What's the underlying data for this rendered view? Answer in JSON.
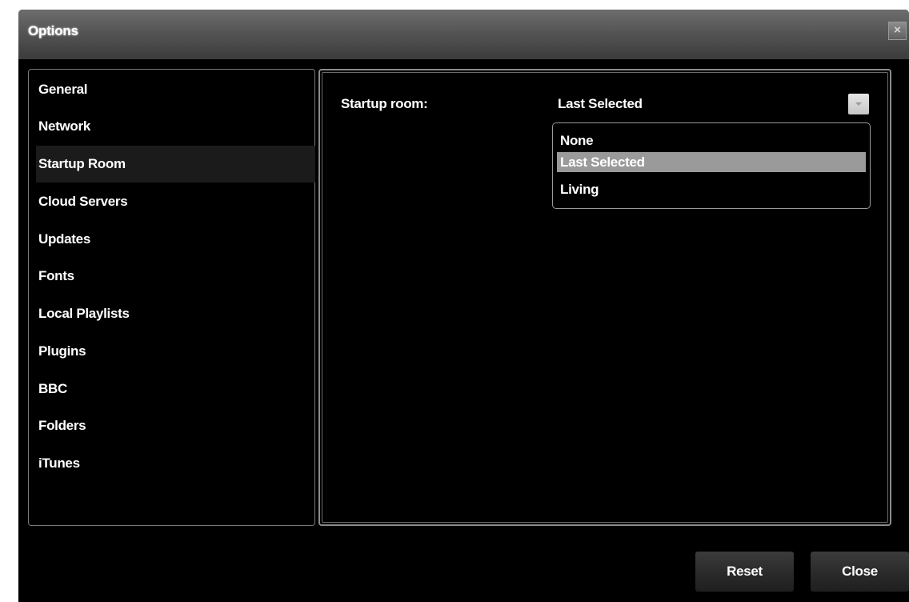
{
  "window": {
    "title": "Options",
    "close_glyph": "×"
  },
  "sidebar": {
    "selected": "Startup Room",
    "items": [
      {
        "label": "General"
      },
      {
        "label": "Network"
      },
      {
        "label": "Startup Room"
      },
      {
        "label": "Cloud Servers"
      },
      {
        "label": "Updates"
      },
      {
        "label": "Fonts"
      },
      {
        "label": "Local Playlists"
      },
      {
        "label": "Plugins"
      },
      {
        "label": "BBC"
      },
      {
        "label": "Folders"
      },
      {
        "label": "iTunes"
      }
    ]
  },
  "startup_room": {
    "label": "Startup room:",
    "selected_value": "Last Selected",
    "dropdown_icon": "chevron-down-icon",
    "options": [
      {
        "label": "None"
      },
      {
        "label": "Last Selected"
      },
      {
        "label": "Living"
      }
    ],
    "highlighted_option": "Last Selected"
  },
  "footer": {
    "reset_label": "Reset",
    "close_label": "Close"
  },
  "colors": {
    "background": "#000000",
    "titlebar": "#555555",
    "selected_item_bg": "#1b1b1b",
    "highlight_option_bg": "#9a9a9a",
    "text": "#ffffff"
  }
}
